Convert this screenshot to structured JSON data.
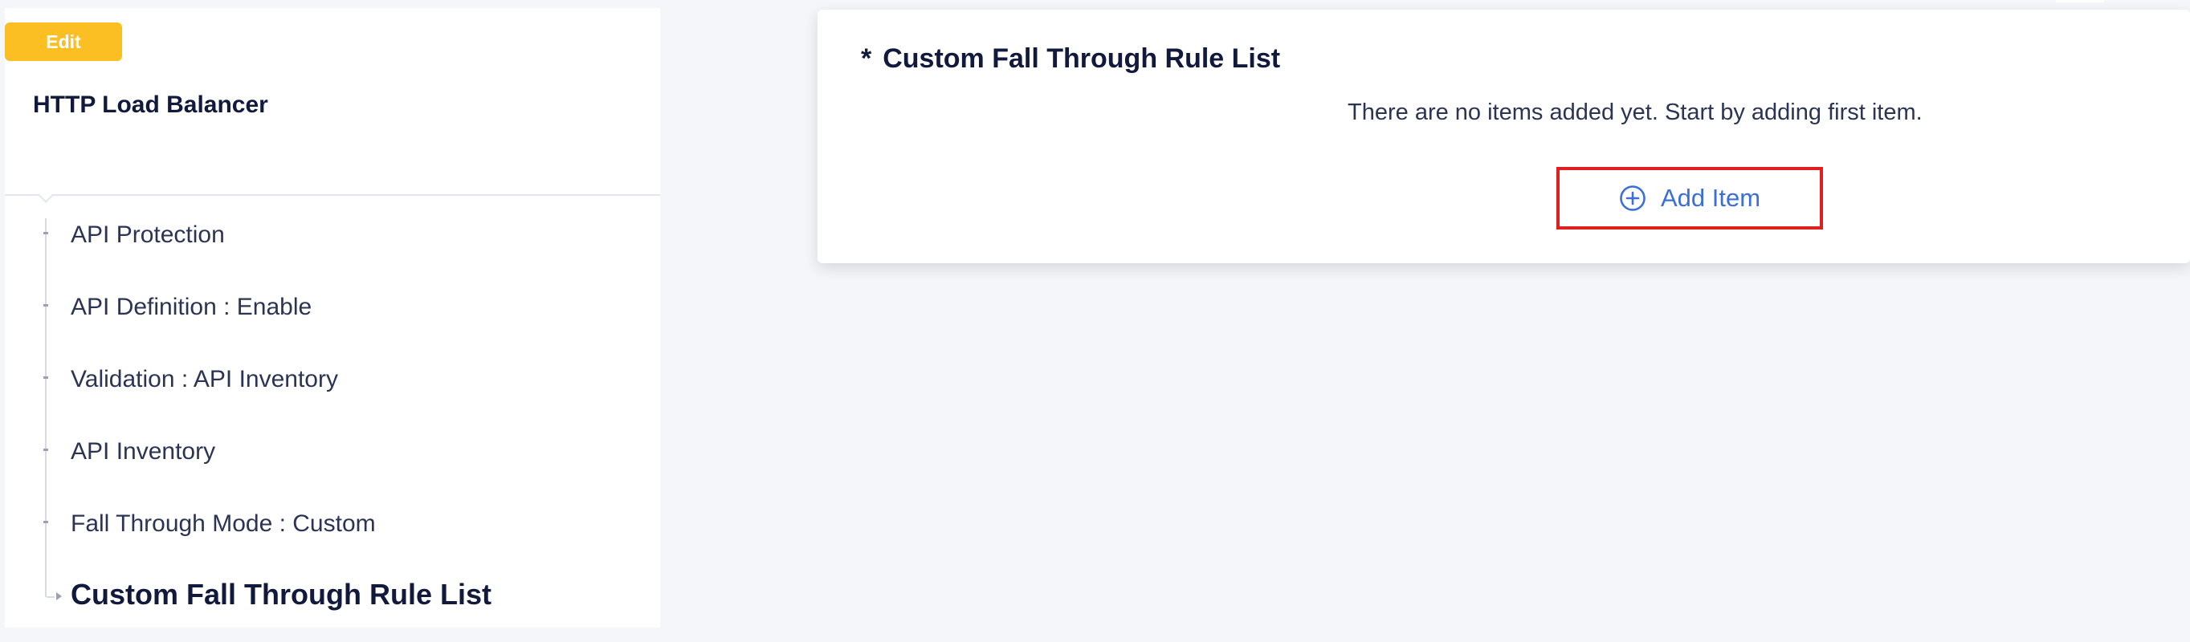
{
  "left_panel": {
    "badge": "Edit",
    "title": "HTTP Load Balancer",
    "items": [
      {
        "label": "API Protection"
      },
      {
        "label": "API Definition : Enable"
      },
      {
        "label": "Validation : API Inventory"
      },
      {
        "label": "API Inventory"
      },
      {
        "label": "Fall Through Mode : Custom"
      },
      {
        "label": "Custom Fall Through Rule List"
      }
    ],
    "current_item_index": 5
  },
  "main": {
    "section_required_marker": "*",
    "section_title": "Custom Fall Through Rule List",
    "empty_message": "There are no items added yet. Start by adding first item.",
    "add_button_label": "Add Item",
    "add_button_icon": "plus-circle-icon"
  },
  "colors": {
    "badge": "#fbbf24",
    "accent": "#3b6ed8",
    "highlight_box": "#e02020",
    "background": "#f5f6f9"
  }
}
